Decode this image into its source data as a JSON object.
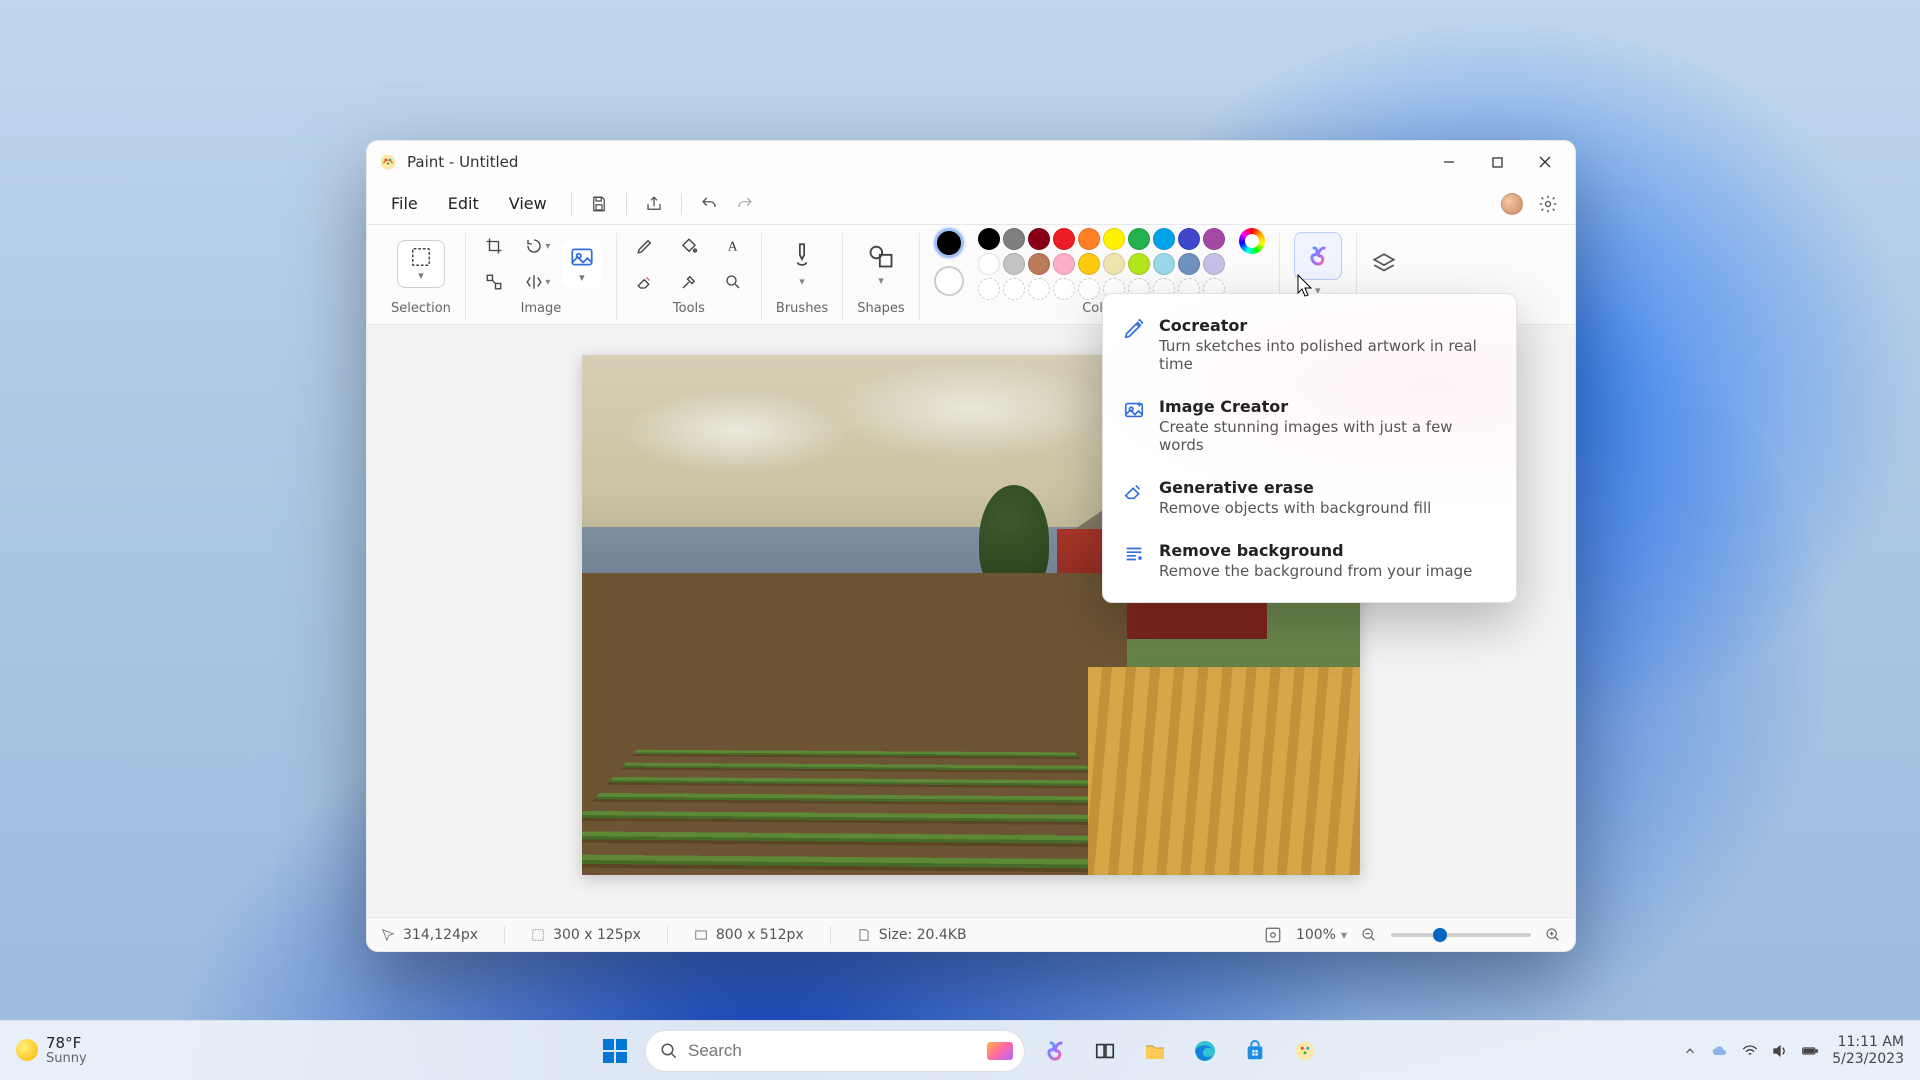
{
  "window": {
    "app_name": "Paint",
    "title_sep": " - ",
    "doc_title": "Untitled"
  },
  "menu": {
    "file": "File",
    "edit": "Edit",
    "view": "View"
  },
  "ribbon": {
    "selection_label": "Selection",
    "image_label": "Image",
    "tools_label": "Tools",
    "brushes_label": "Brushes",
    "shapes_label": "Shapes",
    "color_label": "Color"
  },
  "palette_row1": [
    "#000000",
    "#7f7f7f",
    "#880015",
    "#ed1c24",
    "#ff7f27",
    "#fff200",
    "#22b14c",
    "#00a2e8",
    "#3f48cc",
    "#a349a4"
  ],
  "palette_row2": [
    "#ffffff",
    "#c3c3c3",
    "#b97a57",
    "#ffaec9",
    "#ffc90e",
    "#efe4b0",
    "#b5e61d",
    "#99d9ea",
    "#7092be",
    "#c8bfe7"
  ],
  "palette_row3_empty_count": 10,
  "active_color_primary": "#000000",
  "active_color_secondary": "#ffffff",
  "copilot_menu": [
    {
      "title": "Cocreator",
      "desc": "Turn sketches into polished artwork in real time"
    },
    {
      "title": "Image Creator",
      "desc": "Create stunning images with just a few words"
    },
    {
      "title": "Generative erase",
      "desc": "Remove objects with background fill"
    },
    {
      "title": "Remove background",
      "desc": "Remove the background from your image"
    }
  ],
  "status": {
    "cursor_pos": "314,124px",
    "selection_size": "300  x  125px",
    "canvas_size": "800  x  512px",
    "file_size_label": "Size: ",
    "file_size": "20.4KB",
    "zoom": "100%"
  },
  "taskbar": {
    "search_placeholder": "Search",
    "temp": "78°F",
    "condition": "Sunny",
    "time": "11:11 AM",
    "date": "5/23/2023"
  }
}
